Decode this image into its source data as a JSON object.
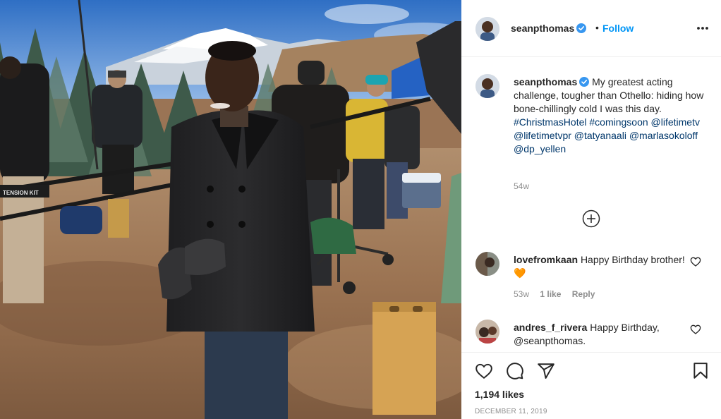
{
  "post": {
    "username": "seanpthomas",
    "verified": true,
    "follow_label": "Follow",
    "dot": "•",
    "caption": {
      "username": "seanpthomas",
      "text": "My greatest acting challenge, tougher than Othello: hiding how bone-chillingly cold I was this day.",
      "tags": "#ChristmasHotel #comingsoon @lifetimetv @lifetimetvpr @tatyanaali @marlasokoloff @dp_yellen",
      "time": "54w"
    },
    "comments": [
      {
        "username": "lovefromkaan",
        "text": "Happy Birthday brother! 🧡",
        "time": "53w",
        "likes": "1 like",
        "reply": "Reply"
      },
      {
        "username": "andres_f_rivera",
        "text": "Happy Birthday, @seanpthomas."
      }
    ],
    "likes": "1,194 likes",
    "date": "DECEMBER 11, 2019"
  },
  "photo": {
    "apple_box_text": "TENSION KIT",
    "subject": "Man in black peacoat and gloves on a snowy-mountain Christmas tree farm film set"
  },
  "icons": {
    "more": "more-options-icon",
    "load_more": "load-more-icon",
    "like": "heart-icon",
    "comment": "comment-icon",
    "share": "share-icon",
    "save": "bookmark-icon",
    "verified": "verified-badge-icon"
  },
  "colors": {
    "link": "#00376b",
    "follow": "#0095f6",
    "verified": "#3897f0",
    "muted": "#8e8e8e",
    "text": "#262626"
  }
}
